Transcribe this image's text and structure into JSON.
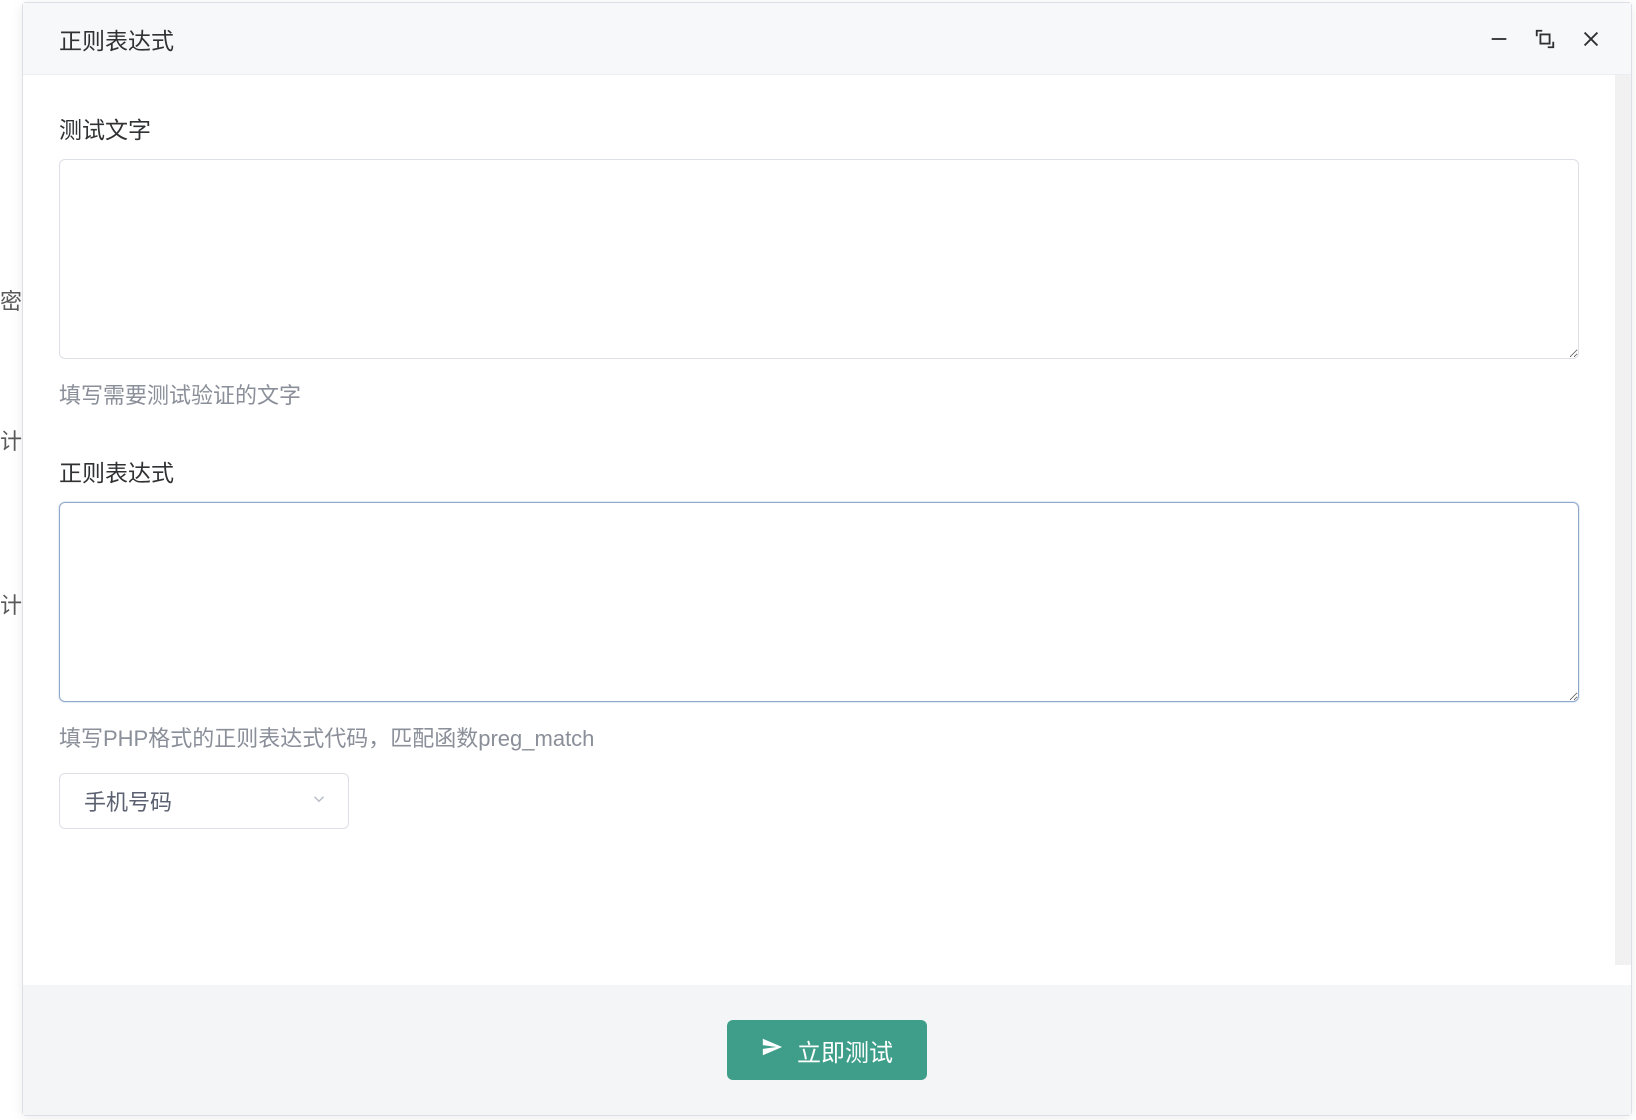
{
  "bg": {
    "h1": "密",
    "h2": "计",
    "h3": "计"
  },
  "dialog": {
    "title": "正则表达式",
    "form": {
      "test_text": {
        "label": "测试文字",
        "value": "",
        "help": "填写需要测试验证的文字"
      },
      "regex": {
        "label": "正则表达式",
        "value": "",
        "help": "填写PHP格式的正则表达式代码，匹配函数preg_match"
      },
      "preset_select": {
        "selected": "手机号码"
      }
    },
    "footer": {
      "submit_label": "立即测试"
    }
  }
}
